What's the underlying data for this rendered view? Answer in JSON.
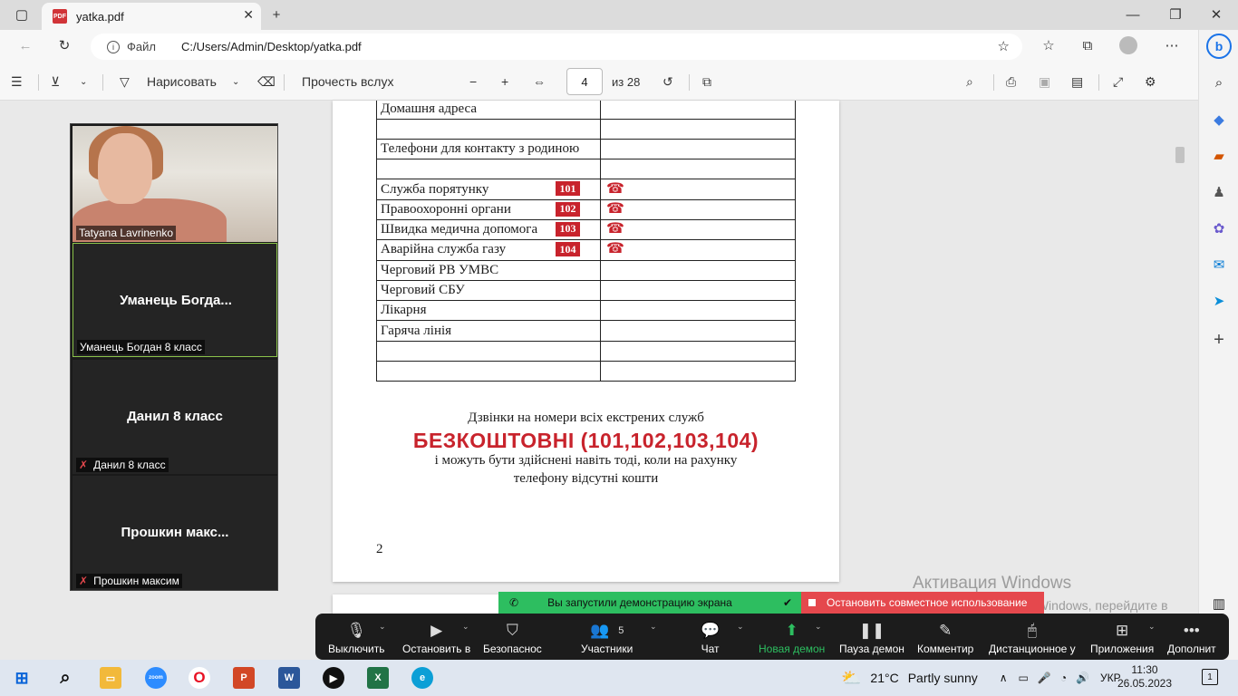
{
  "browser": {
    "tab_title": "yatka.pdf",
    "address_label": "Файл",
    "address_url": "C:/Users/Admin/Desktop/yatka.pdf"
  },
  "pdf_toolbar": {
    "draw_label": "Нарисовать",
    "read_aloud_label": "Прочесть вслух",
    "page_current": "4",
    "page_of": "из 28"
  },
  "document": {
    "rows": [
      {
        "label": "Домашня адреса",
        "badge": ""
      },
      {
        "label": "",
        "badge": ""
      },
      {
        "label": "Телефони для контакту з родиною",
        "badge": ""
      },
      {
        "label": "",
        "badge": ""
      },
      {
        "label": "Служба порятунку",
        "badge": "101"
      },
      {
        "label": "Правоохоронні органи",
        "badge": "102"
      },
      {
        "label": "Швидка медична допомога",
        "badge": "103"
      },
      {
        "label": "Аварійна служба газу",
        "badge": "104"
      },
      {
        "label": "Черговий  РВ УМВС",
        "badge": ""
      },
      {
        "label": "Черговий СБУ",
        "badge": ""
      },
      {
        "label": "Лікарня",
        "badge": ""
      },
      {
        "label": "Гаряча лінія",
        "badge": ""
      },
      {
        "label": "",
        "badge": ""
      },
      {
        "label": "",
        "badge": ""
      }
    ],
    "note_line1": "Дзвінки на номери всіх екстрених служб",
    "note_highlight": "БЕЗКОШТОВНІ (101,102,103,104)",
    "note_line3": "і можуть бути здійснені навіть  тоді, коли на рахунку",
    "note_line4": "телефону відсутні кошти",
    "page_number": "2"
  },
  "zoom": {
    "participants": [
      {
        "display": "",
        "tag": "Tatyana Lavrinenko",
        "muted": false
      },
      {
        "display": "Уманець  Богда...",
        "tag": "Уманець Богдан 8 класс",
        "muted": false
      },
      {
        "display": "Данил 8 класс",
        "tag": "Данил 8 класс",
        "muted": true
      },
      {
        "display": "Прошкин  макс...",
        "tag": "Прошкин максим",
        "muted": true
      }
    ],
    "share_notice": "Вы запустили демонстрацию экрана",
    "stop_share": "Остановить совместное использование",
    "controls": {
      "mute": "Выключить",
      "video": "Остановить в",
      "security": "Безопаснос",
      "participants": "Участники",
      "participants_count": "5",
      "chat": "Чат",
      "share": "Новая демон",
      "pause": "Пауза демон",
      "annotate": "Комментир",
      "remote": "Дистанционное у",
      "apps": "Приложения",
      "more": "Дополнит"
    }
  },
  "watermark": {
    "title": "Активация Windows",
    "body": "Чтобы активировать Windows, перейдите в раздел \"Параметры\"."
  },
  "taskbar": {
    "weather_temp": "21°C",
    "weather_desc": "Partly sunny",
    "language": "УКР",
    "time": "11:30",
    "date": "26.05.2023",
    "notification_count": "1"
  },
  "colors": {
    "accent_red": "#c8232c",
    "zoom_green": "#2dbe60",
    "zoom_red": "#e5484d"
  }
}
